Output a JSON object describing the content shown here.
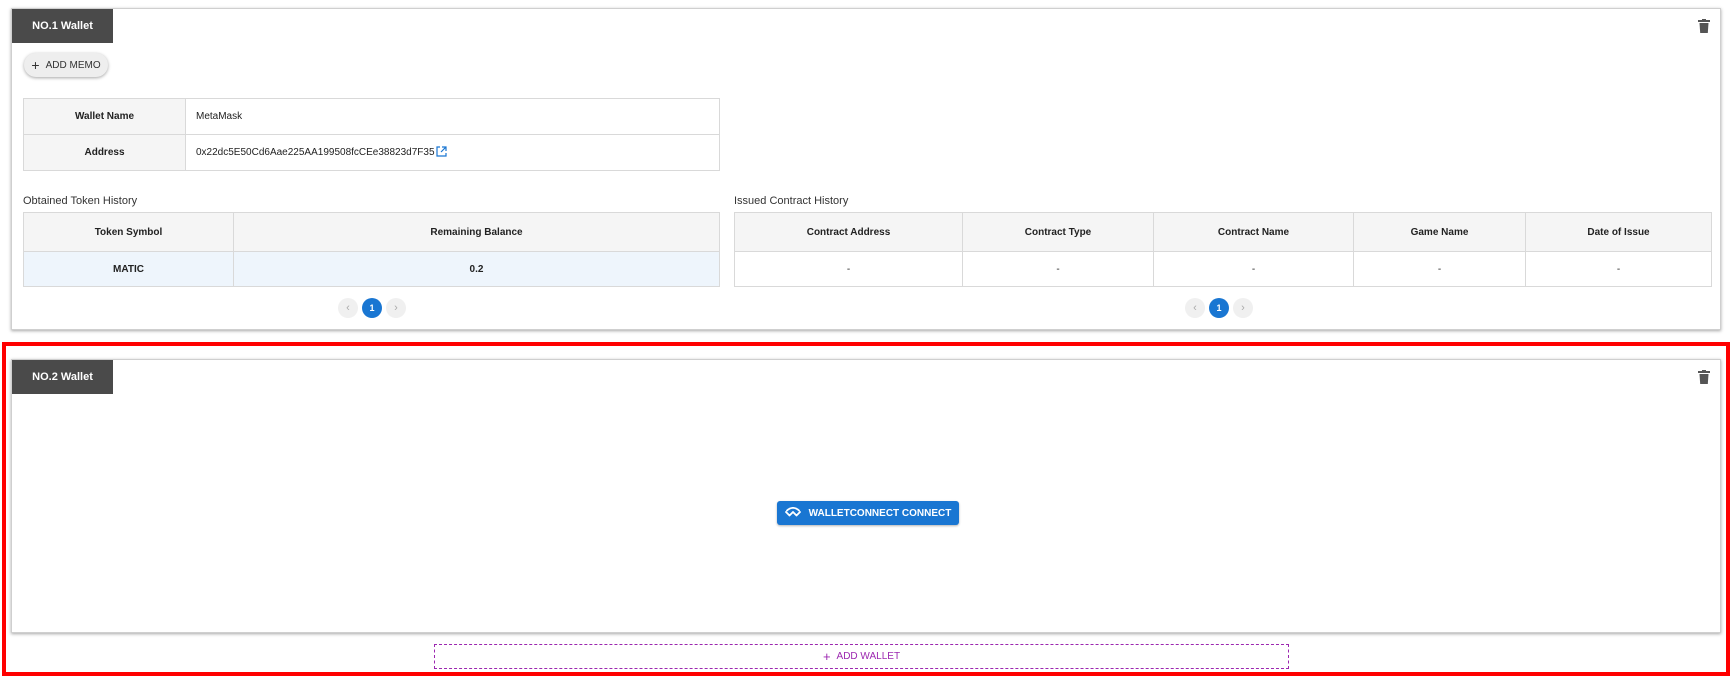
{
  "wallets": [
    {
      "tab_label": "NO.1 Wallet",
      "memo_button": "ADD MEMO",
      "info": {
        "name_label": "Wallet Name",
        "name_value": "MetaMask",
        "address_label": "Address",
        "address_value": "0x22dc5E50Cd6Aae225AA199508fcCEe38823d7F35"
      },
      "token_history": {
        "title": "Obtained Token History",
        "columns": [
          "Token Symbol",
          "Remaining Balance"
        ],
        "rows": [
          [
            "MATIC",
            "0.2"
          ]
        ],
        "page": "1"
      },
      "contract_history": {
        "title": "Issued Contract History",
        "columns": [
          "Contract Address",
          "Contract Type",
          "Contract Name",
          "Game Name",
          "Date of Issue"
        ],
        "rows": [
          [
            "-",
            "-",
            "-",
            "-",
            "-"
          ]
        ],
        "page": "1"
      }
    },
    {
      "tab_label": "NO.2 Wallet",
      "connect_button": "WALLETCONNECT CONNECT"
    }
  ],
  "add_wallet_button": "ADD WALLET",
  "icons": {
    "delete": "trash-icon",
    "external_link": "external-link-icon",
    "walletconnect": "walletconnect-icon",
    "add": "plus-icon"
  },
  "colors": {
    "tab_bg": "#4a4a4a",
    "primary": "#1976d2",
    "add_wallet": "#9c27b0",
    "highlight": "#ff0000"
  }
}
